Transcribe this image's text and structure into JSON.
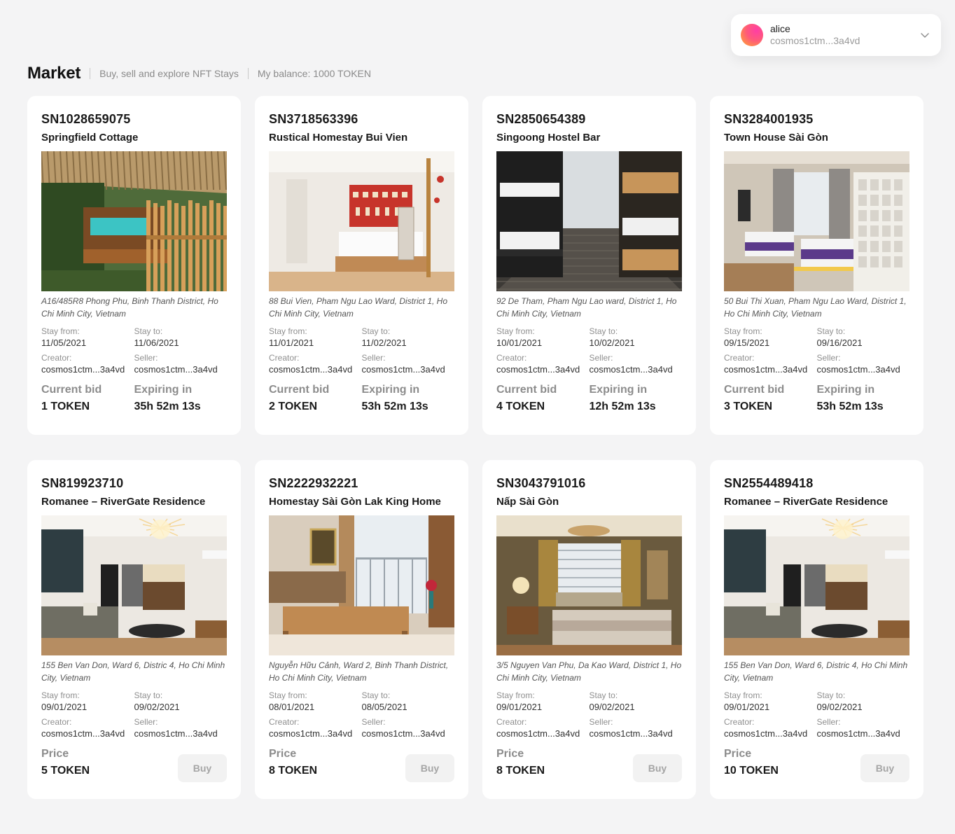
{
  "account": {
    "name": "alice",
    "address": "cosmos1ctm...3a4vd",
    "avatar_colors": [
      "#ff3ea5",
      "#ffae2b"
    ]
  },
  "header": {
    "title": "Market",
    "subtitle": "Buy, sell and explore NFT Stays",
    "balance": "My balance: 1000 TOKEN"
  },
  "labels": {
    "stay_from": "Stay from:",
    "stay_to": "Stay to:",
    "creator": "Creator:",
    "seller": "Seller:",
    "current_bid": "Current bid",
    "expiring_in": "Expiring in",
    "price": "Price",
    "buy": "Buy"
  },
  "cards": [
    {
      "sn": "SN1028659075",
      "name": "Springfield Cottage",
      "address": "A16/485R8 Phong Phu, Binh Thanh District, Ho Chi Minh City, Vietnam",
      "stay_from": "11/05/2021",
      "stay_to": "11/06/2021",
      "creator": "cosmos1ctm...3a4vd",
      "seller": "cosmos1ctm...3a4vd",
      "mode": "auction",
      "current_bid": "1 TOKEN",
      "expiring_in": "35h 52m 13s",
      "photo": "cottage"
    },
    {
      "sn": "SN3718563396",
      "name": "Rustical Homestay Bui Vien",
      "address": "88 Bui Vien, Pham Ngu Lao Ward, District 1, Ho Chi Minh City, Vietnam",
      "stay_from": "11/01/2021",
      "stay_to": "11/02/2021",
      "creator": "cosmos1ctm...3a4vd",
      "seller": "cosmos1ctm...3a4vd",
      "mode": "auction",
      "current_bid": "2 TOKEN",
      "expiring_in": "53h 52m 13s",
      "photo": "bedroom-white"
    },
    {
      "sn": "SN2850654389",
      "name": "Singoong Hostel Bar",
      "address": "92 De Tham, Pham Ngu Lao ward, District 1, Ho Chi Minh City, Vietnam",
      "stay_from": "10/01/2021",
      "stay_to": "10/02/2021",
      "creator": "cosmos1ctm...3a4vd",
      "seller": "cosmos1ctm...3a4vd",
      "mode": "auction",
      "current_bid": "4 TOKEN",
      "expiring_in": "12h 52m 13s",
      "photo": "hostel"
    },
    {
      "sn": "SN3284001935",
      "name": "Town House Sài Gòn",
      "address": "50 Bui Thi Xuan, Pham Ngu Lao Ward, District 1, Ho Chi Minh City, Vietnam",
      "stay_from": "09/15/2021",
      "stay_to": "09/16/2021",
      "creator": "cosmos1ctm...3a4vd",
      "seller": "cosmos1ctm...3a4vd",
      "mode": "auction",
      "current_bid": "3 TOKEN",
      "expiring_in": "53h 52m 13s",
      "photo": "hotel-room"
    },
    {
      "sn": "SN819923710",
      "name": "Romanee – RiverGate Residence",
      "address": "155 Ben Van Don, Ward 6, Distric 4, Ho Chi Minh City, Vietnam",
      "stay_from": "09/01/2021",
      "stay_to": "09/02/2021",
      "creator": "cosmos1ctm...3a4vd",
      "seller": "cosmos1ctm...3a4vd",
      "mode": "sale",
      "price": "5 TOKEN",
      "photo": "living-room"
    },
    {
      "sn": "SN2222932221",
      "name": "Homestay Sài Gòn Lak King Home",
      "address": "Nguyễn Hữu Cảnh, Ward 2, Binh Thanh District, Ho Chi Minh City, Vietnam",
      "stay_from": "08/01/2021",
      "stay_to": "08/05/2021",
      "creator": "cosmos1ctm...3a4vd",
      "seller": "cosmos1ctm...3a4vd",
      "mode": "sale",
      "price": "8 TOKEN",
      "photo": "apartment"
    },
    {
      "sn": "SN3043791016",
      "name": "Nấp Sài Gòn",
      "address": "3/5 Nguyen Van Phu, Da Kao Ward, District 1, Ho Chi Minh City, Vietnam",
      "stay_from": "09/01/2021",
      "stay_to": "09/02/2021",
      "creator": "cosmos1ctm...3a4vd",
      "seller": "cosmos1ctm...3a4vd",
      "mode": "sale",
      "price": "8 TOKEN",
      "photo": "vintage-bedroom"
    },
    {
      "sn": "SN2554489418",
      "name": "Romanee – RiverGate Residence",
      "address": "155 Ben Van Don, Ward 6, Distric 4, Ho Chi Minh City, Vietnam",
      "stay_from": "09/01/2021",
      "stay_to": "09/02/2021",
      "creator": "cosmos1ctm...3a4vd",
      "seller": "cosmos1ctm...3a4vd",
      "mode": "sale",
      "price": "10 TOKEN",
      "photo": "living-room"
    }
  ]
}
